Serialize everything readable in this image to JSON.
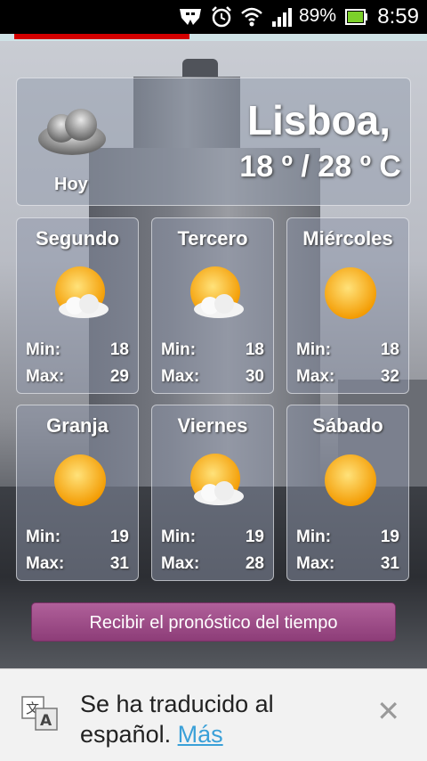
{
  "status_bar": {
    "battery_percent": "89%",
    "time": "8:59",
    "icons": [
      "mask-icon",
      "alarm-icon",
      "wifi-icon",
      "signal-icon",
      "battery-icon"
    ]
  },
  "page_load_progress": 0.44,
  "header": {
    "city": "Lisboa,",
    "temperature": "18 º / 28 º C",
    "today_label": "Hoy",
    "today_icon": "cloud-icon"
  },
  "forecast": [
    {
      "day": "Segundo",
      "icon": "sun-cloud-icon",
      "min_label": "Min:",
      "min": "18",
      "max_label": "Max:",
      "max": "29"
    },
    {
      "day": "Tercero",
      "icon": "sun-cloud-icon",
      "min_label": "Min:",
      "min": "18",
      "max_label": "Max:",
      "max": "30"
    },
    {
      "day": "Miércoles",
      "icon": "sun-icon",
      "min_label": "Min:",
      "min": "18",
      "max_label": "Max:",
      "max": "32"
    },
    {
      "day": "Granja",
      "icon": "sun-icon",
      "min_label": "Min:",
      "min": "19",
      "max_label": "Max:",
      "max": "31"
    },
    {
      "day": "Viernes",
      "icon": "sun-cloud-icon",
      "min_label": "Min:",
      "min": "19",
      "max_label": "Max:",
      "max": "28"
    },
    {
      "day": "Sábado",
      "icon": "sun-icon",
      "min_label": "Min:",
      "min": "19",
      "max_label": "Max:",
      "max": "31"
    }
  ],
  "forecast_button": "Recibir el pronóstico del tiempo",
  "translation_bar": {
    "text": "Se ha traducido al español.",
    "more_link": "Más",
    "close_icon": "close-icon",
    "translate_icon": "translate-icon"
  },
  "colors": {
    "button": "#9a4a86",
    "link": "#3aa0d8",
    "progress": "#d40000"
  }
}
